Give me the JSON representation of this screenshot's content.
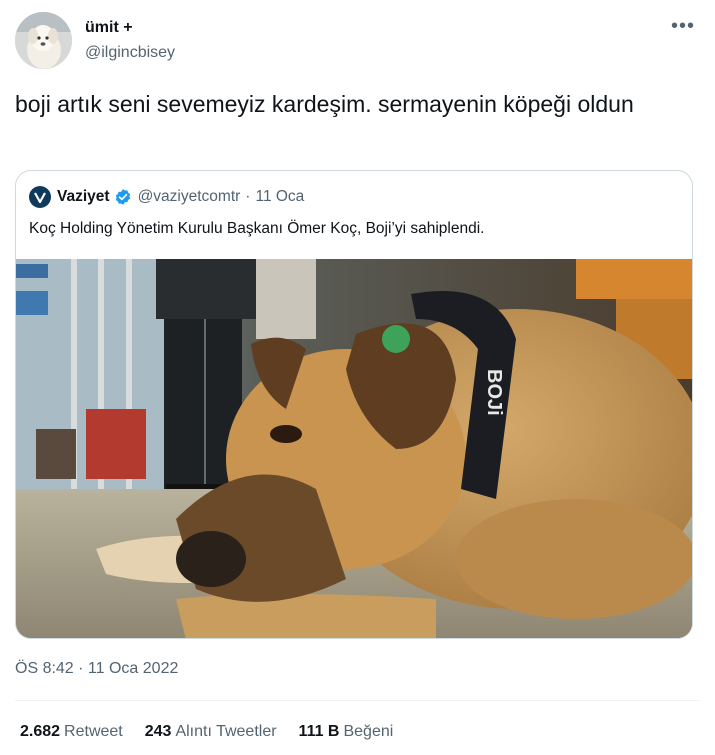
{
  "author": {
    "display_name": "ümit +",
    "handle": "@ilgincbisey"
  },
  "more_icon": "more-horizontal-icon",
  "tweet": {
    "text": "boji artık seni sevemeyiz kardeşim. sermayenin köpeği oldun"
  },
  "quoted": {
    "display_name": "Vaziyet",
    "verified_icon": "verified-badge-icon",
    "handle": "@vaziyetcomtr",
    "separator": "·",
    "date": "11 Oca",
    "text": "Koç Holding Yönetim Kurulu Başkanı Ömer Koç, Boji’yi sahiplendi.",
    "collar_text": "BOJi",
    "colors": {
      "avatar_bg": "#0f3a5c",
      "verified": "#1d9bf0"
    }
  },
  "timestamp": "ÖS 8:42 · 11 Oca 2022",
  "stats": {
    "retweets": {
      "count": "2.682",
      "label": "Retweet"
    },
    "quotes": {
      "count": "243",
      "label": "Alıntı Tweetler"
    },
    "likes": {
      "count": "111 B",
      "label": "Beğeni"
    }
  }
}
